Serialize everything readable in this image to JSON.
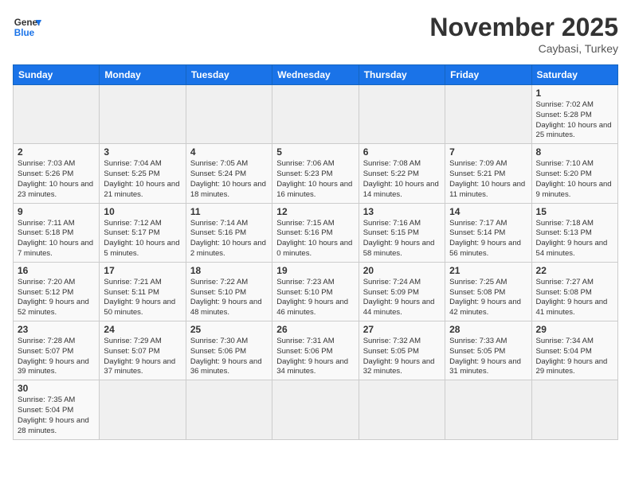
{
  "header": {
    "logo_general": "General",
    "logo_blue": "Blue",
    "month_title": "November 2025",
    "subtitle": "Caybasi, Turkey"
  },
  "weekdays": [
    "Sunday",
    "Monday",
    "Tuesday",
    "Wednesday",
    "Thursday",
    "Friday",
    "Saturday"
  ],
  "days": [
    {
      "num": "",
      "info": ""
    },
    {
      "num": "",
      "info": ""
    },
    {
      "num": "",
      "info": ""
    },
    {
      "num": "",
      "info": ""
    },
    {
      "num": "",
      "info": ""
    },
    {
      "num": "",
      "info": ""
    },
    {
      "num": "1",
      "info": "Sunrise: 7:02 AM\nSunset: 5:28 PM\nDaylight: 10 hours and 25 minutes."
    },
    {
      "num": "2",
      "info": "Sunrise: 7:03 AM\nSunset: 5:26 PM\nDaylight: 10 hours and 23 minutes."
    },
    {
      "num": "3",
      "info": "Sunrise: 7:04 AM\nSunset: 5:25 PM\nDaylight: 10 hours and 21 minutes."
    },
    {
      "num": "4",
      "info": "Sunrise: 7:05 AM\nSunset: 5:24 PM\nDaylight: 10 hours and 18 minutes."
    },
    {
      "num": "5",
      "info": "Sunrise: 7:06 AM\nSunset: 5:23 PM\nDaylight: 10 hours and 16 minutes."
    },
    {
      "num": "6",
      "info": "Sunrise: 7:08 AM\nSunset: 5:22 PM\nDaylight: 10 hours and 14 minutes."
    },
    {
      "num": "7",
      "info": "Sunrise: 7:09 AM\nSunset: 5:21 PM\nDaylight: 10 hours and 11 minutes."
    },
    {
      "num": "8",
      "info": "Sunrise: 7:10 AM\nSunset: 5:20 PM\nDaylight: 10 hours and 9 minutes."
    },
    {
      "num": "9",
      "info": "Sunrise: 7:11 AM\nSunset: 5:18 PM\nDaylight: 10 hours and 7 minutes."
    },
    {
      "num": "10",
      "info": "Sunrise: 7:12 AM\nSunset: 5:17 PM\nDaylight: 10 hours and 5 minutes."
    },
    {
      "num": "11",
      "info": "Sunrise: 7:14 AM\nSunset: 5:16 PM\nDaylight: 10 hours and 2 minutes."
    },
    {
      "num": "12",
      "info": "Sunrise: 7:15 AM\nSunset: 5:16 PM\nDaylight: 10 hours and 0 minutes."
    },
    {
      "num": "13",
      "info": "Sunrise: 7:16 AM\nSunset: 5:15 PM\nDaylight: 9 hours and 58 minutes."
    },
    {
      "num": "14",
      "info": "Sunrise: 7:17 AM\nSunset: 5:14 PM\nDaylight: 9 hours and 56 minutes."
    },
    {
      "num": "15",
      "info": "Sunrise: 7:18 AM\nSunset: 5:13 PM\nDaylight: 9 hours and 54 minutes."
    },
    {
      "num": "16",
      "info": "Sunrise: 7:20 AM\nSunset: 5:12 PM\nDaylight: 9 hours and 52 minutes."
    },
    {
      "num": "17",
      "info": "Sunrise: 7:21 AM\nSunset: 5:11 PM\nDaylight: 9 hours and 50 minutes."
    },
    {
      "num": "18",
      "info": "Sunrise: 7:22 AM\nSunset: 5:10 PM\nDaylight: 9 hours and 48 minutes."
    },
    {
      "num": "19",
      "info": "Sunrise: 7:23 AM\nSunset: 5:10 PM\nDaylight: 9 hours and 46 minutes."
    },
    {
      "num": "20",
      "info": "Sunrise: 7:24 AM\nSunset: 5:09 PM\nDaylight: 9 hours and 44 minutes."
    },
    {
      "num": "21",
      "info": "Sunrise: 7:25 AM\nSunset: 5:08 PM\nDaylight: 9 hours and 42 minutes."
    },
    {
      "num": "22",
      "info": "Sunrise: 7:27 AM\nSunset: 5:08 PM\nDaylight: 9 hours and 41 minutes."
    },
    {
      "num": "23",
      "info": "Sunrise: 7:28 AM\nSunset: 5:07 PM\nDaylight: 9 hours and 39 minutes."
    },
    {
      "num": "24",
      "info": "Sunrise: 7:29 AM\nSunset: 5:07 PM\nDaylight: 9 hours and 37 minutes."
    },
    {
      "num": "25",
      "info": "Sunrise: 7:30 AM\nSunset: 5:06 PM\nDaylight: 9 hours and 36 minutes."
    },
    {
      "num": "26",
      "info": "Sunrise: 7:31 AM\nSunset: 5:06 PM\nDaylight: 9 hours and 34 minutes."
    },
    {
      "num": "27",
      "info": "Sunrise: 7:32 AM\nSunset: 5:05 PM\nDaylight: 9 hours and 32 minutes."
    },
    {
      "num": "28",
      "info": "Sunrise: 7:33 AM\nSunset: 5:05 PM\nDaylight: 9 hours and 31 minutes."
    },
    {
      "num": "29",
      "info": "Sunrise: 7:34 AM\nSunset: 5:04 PM\nDaylight: 9 hours and 29 minutes."
    },
    {
      "num": "30",
      "info": "Sunrise: 7:35 AM\nSunset: 5:04 PM\nDaylight: 9 hours and 28 minutes."
    }
  ]
}
